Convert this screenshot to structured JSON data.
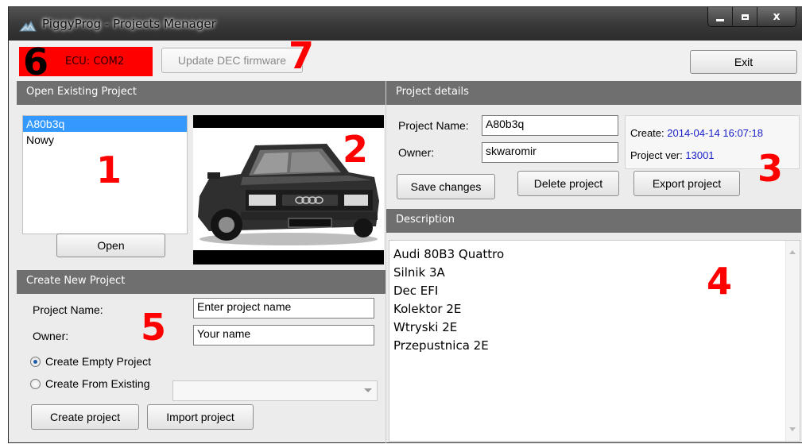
{
  "window": {
    "title": "PiggyProg - Projects Menager",
    "controls": {
      "minimize": "minimize-icon",
      "maximize": "maximize-icon",
      "close_label": "x"
    }
  },
  "toolbar": {
    "ecu_status": "ECU: COM2",
    "ecu_color": "#ff0000",
    "update_label": "Update DEC firmware",
    "exit_label": "Exit"
  },
  "open_project": {
    "header": "Open Existing Project",
    "items": [
      {
        "label": "A80b3q",
        "selected": true
      },
      {
        "label": "Nowy",
        "selected": false
      }
    ],
    "open_label": "Open",
    "image": "car-photo"
  },
  "create_project": {
    "header": "Create New Project",
    "name_label": "Project Name:",
    "name_value": "Enter project name",
    "owner_label": "Owner:",
    "owner_value": "Your name",
    "radio_empty": "Create Empty Project",
    "radio_existing": "Create From Existing",
    "selected_radio": "empty",
    "existing_select_value": "",
    "create_label": "Create project",
    "import_label": "Import project"
  },
  "project_details": {
    "header": "Project details",
    "name_label": "Project Name:",
    "name_value": "A80b3q",
    "owner_label": "Owner:",
    "owner_value": "skwaromir",
    "create_label": "Create:",
    "create_value": "2014-04-14 16:07:18",
    "version_label": "Project ver:",
    "version_value": "13001",
    "value_color": "#1a20c6",
    "save_label": "Save changes",
    "delete_label": "Delete project",
    "export_label": "Export project"
  },
  "description": {
    "header": "Description",
    "lines": [
      "Audi 80B3 Quattro",
      "Silnik 3A",
      "Dec EFI",
      "Kolektor 2E",
      "Wtryski 2E",
      "Przepustnica 2E"
    ]
  },
  "annotations": {
    "n1": "1",
    "n2": "2",
    "n3": "3",
    "n4": "4",
    "n5": "5",
    "n6": "6",
    "n7": "7",
    "color_red": "#ff0000",
    "color_black": "#000000"
  }
}
